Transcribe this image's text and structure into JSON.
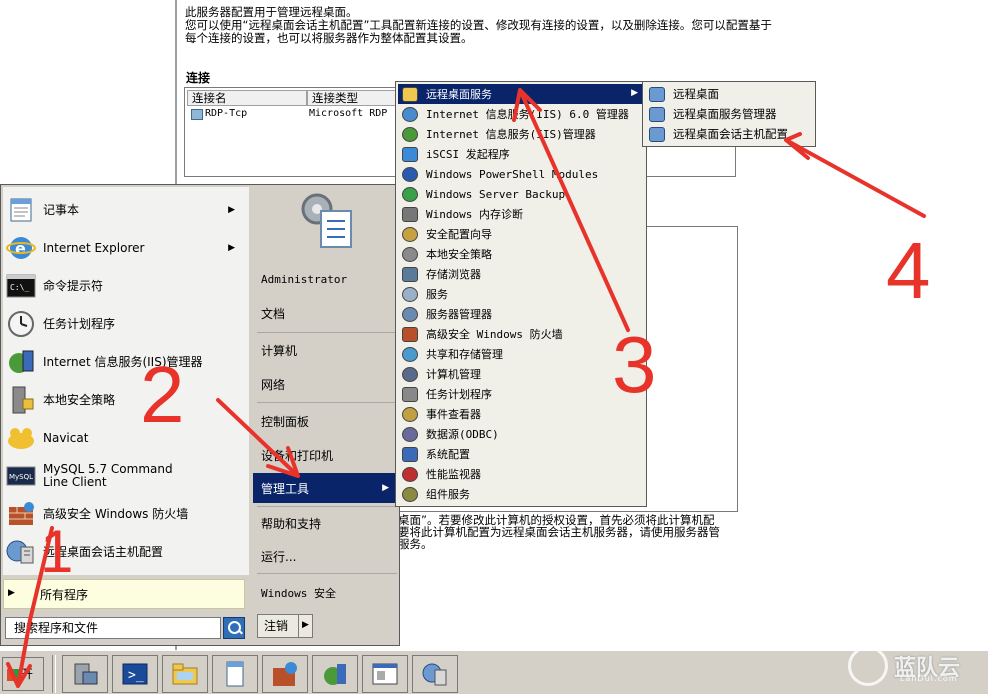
{
  "background": {
    "description": "此服务器配置用于管理远程桌面。\n您可以使用“远程桌面会话主机配置”工具配置新连接的设置、修改现有连接的设置，以及删除连接。您可以配置基于\n每个连接的设置，也可以将服务器作为整体配置其设置。",
    "connections_title": "连接",
    "columns": [
      "连接名",
      "连接类型"
    ],
    "row": {
      "name": "RDP-Tcp",
      "type": "Microsoft RDP"
    },
    "bottom_text": "桌面”。若要修改此计算机的授权设置，首先必须将此计算机配\n要将此计算机配置为远程桌面会话主机服务器，请使用服务器管\n服务。"
  },
  "start_menu": {
    "left_items": [
      {
        "label": "记事本",
        "icon": "notepad-icon",
        "arrow": true
      },
      {
        "label": "Internet Explorer",
        "icon": "ie-icon",
        "arrow": true
      },
      {
        "label": "命令提示符",
        "icon": "cmd-icon",
        "arrow": false
      },
      {
        "label": "任务计划程序",
        "icon": "clock-icon",
        "arrow": false
      },
      {
        "label": "Internet 信息服务(IIS)管理器",
        "icon": "iis-icon",
        "arrow": false
      },
      {
        "label": "本地安全策略",
        "icon": "security-policy-icon",
        "arrow": false
      },
      {
        "label": "Navicat",
        "icon": "navicat-icon",
        "arrow": false
      },
      {
        "label": "MySQL 5.7 Command Line Client",
        "icon": "mysql-icon",
        "arrow": false
      },
      {
        "label": "高级安全 Windows 防火墙",
        "icon": "firewall-icon",
        "arrow": false
      },
      {
        "label": "远程桌面会话主机配置",
        "icon": "rds-config-icon",
        "arrow": false
      }
    ],
    "all_programs": "所有程序",
    "search_placeholder": "搜索程序和文件",
    "right_items": {
      "user": "Administrator",
      "documents": "文档",
      "computer": "计算机",
      "network": "网络",
      "control_panel": "控制面板",
      "devices": "设备和打印机",
      "admin_tools": "管理工具",
      "help": "帮助和支持",
      "run": "运行...",
      "windows_security": "Windows 安全"
    },
    "logoff": "注销"
  },
  "admin_tools_menu": [
    {
      "label": "远程桌面服务",
      "icon": "folder-icon",
      "highlighted": true,
      "arrow": true
    },
    {
      "label": "Internet 信息服务(IIS) 6.0 管理器",
      "icon": "iis6-icon"
    },
    {
      "label": "Internet 信息服务(IIS)管理器",
      "icon": "iis-icon"
    },
    {
      "label": "iSCSI 发起程序",
      "icon": "iscsi-icon"
    },
    {
      "label": "Windows PowerShell Modules",
      "icon": "powershell-icon"
    },
    {
      "label": "Windows Server Backup",
      "icon": "backup-icon"
    },
    {
      "label": "Windows 内存诊断",
      "icon": "memory-icon"
    },
    {
      "label": "安全配置向导",
      "icon": "security-wizard-icon"
    },
    {
      "label": "本地安全策略",
      "icon": "security-policy-icon"
    },
    {
      "label": "存储浏览器",
      "icon": "storage-icon"
    },
    {
      "label": "服务",
      "icon": "services-icon"
    },
    {
      "label": "服务器管理器",
      "icon": "server-manager-icon"
    },
    {
      "label": "高级安全 Windows 防火墙",
      "icon": "firewall-icon"
    },
    {
      "label": "共享和存储管理",
      "icon": "share-icon"
    },
    {
      "label": "计算机管理",
      "icon": "computer-mgmt-icon"
    },
    {
      "label": "任务计划程序",
      "icon": "clock-icon"
    },
    {
      "label": "事件查看器",
      "icon": "event-viewer-icon"
    },
    {
      "label": "数据源(ODBC)",
      "icon": "odbc-icon"
    },
    {
      "label": "系统配置",
      "icon": "sysconfig-icon"
    },
    {
      "label": "性能监视器",
      "icon": "perfmon-icon"
    },
    {
      "label": "组件服务",
      "icon": "component-icon"
    }
  ],
  "rds_menu": [
    {
      "label": "远程桌面",
      "icon": "remote-desktop-icon"
    },
    {
      "label": "远程桌面服务管理器",
      "icon": "rds-manager-icon"
    },
    {
      "label": "远程桌面会话主机配置",
      "icon": "rds-config-icon"
    }
  ],
  "taskbar": {
    "start_label": "开始",
    "items": [
      "server-manager-icon",
      "powershell-icon",
      "explorer-icon",
      "notepad-icon",
      "firewall-icon",
      "iis-icon",
      "window-icon",
      "rds-config-icon"
    ]
  },
  "watermark": {
    "text": "蓝队云",
    "sub": "LanDui.com"
  },
  "annotations": [
    "1",
    "2",
    "3",
    "4"
  ],
  "colors": {
    "highlight": "#0a246a",
    "menu_bg": "#f0efe8",
    "annotation": "#e8332a"
  }
}
